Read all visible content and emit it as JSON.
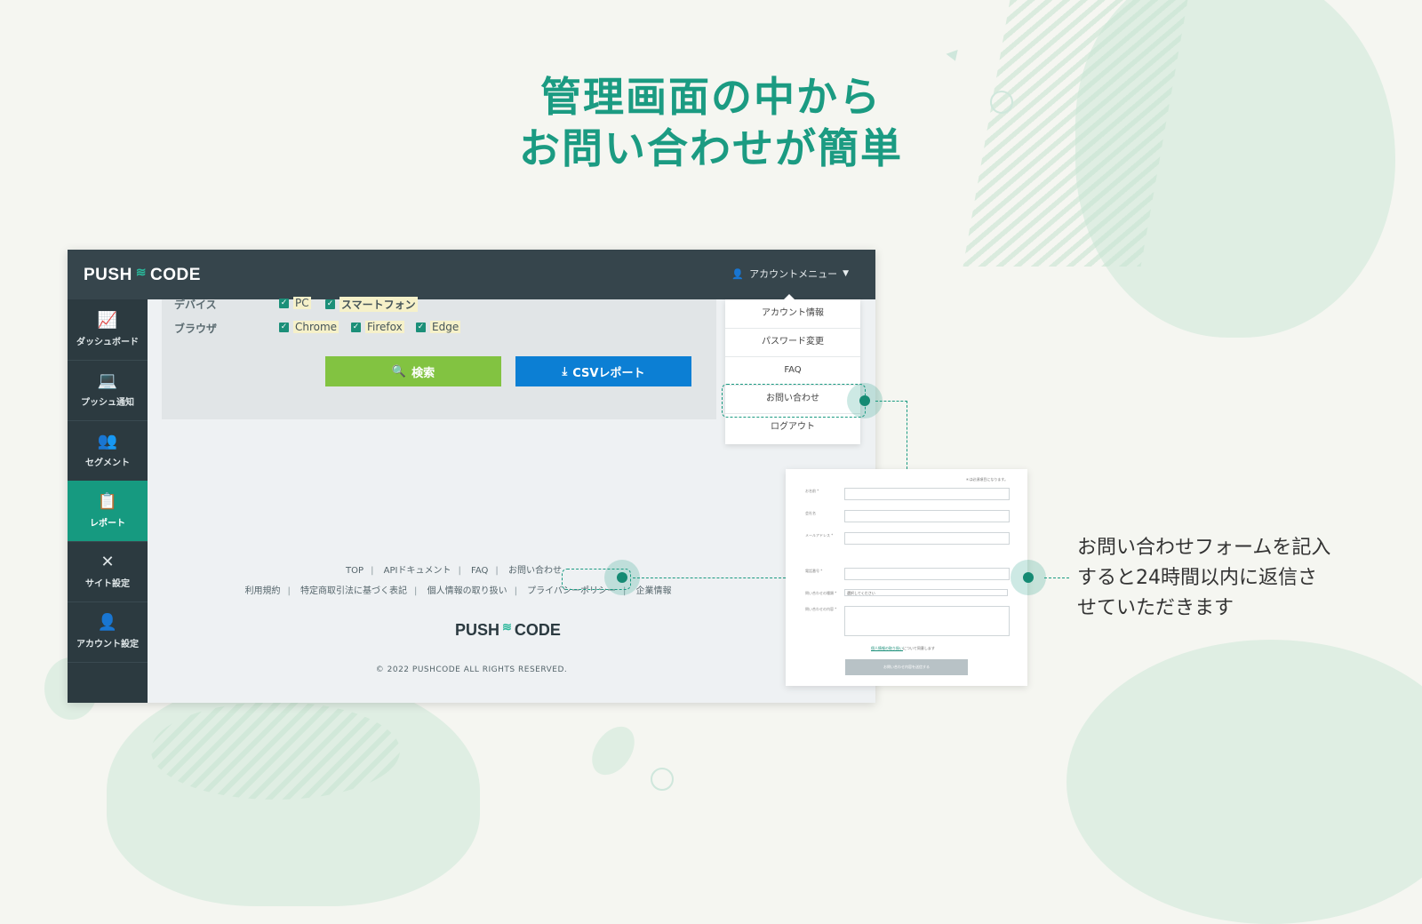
{
  "headline": {
    "line1": "管理画面の中から",
    "line2": "お問い合わせが簡単"
  },
  "app": {
    "logo": {
      "left": "PUSH",
      "right": "CODE"
    },
    "account_menu_label": "アカウントメニュー",
    "sidebar": [
      {
        "label": "ダッシュボード",
        "icon": "chart-icon",
        "active": false
      },
      {
        "label": "プッシュ通知",
        "icon": "laptop-icon",
        "active": false
      },
      {
        "label": "セグメント",
        "icon": "users-icon",
        "active": false
      },
      {
        "label": "レポート",
        "icon": "clipboard-icon",
        "active": true
      },
      {
        "label": "サイト設定",
        "icon": "tools-icon",
        "active": false
      },
      {
        "label": "アカウント設定",
        "icon": "person-icon",
        "active": false
      }
    ],
    "filters": {
      "device_label": "デバイス",
      "device_options": [
        "PC",
        "スマートフォン"
      ],
      "browser_label": "ブラウザ",
      "browser_options": [
        "Chrome",
        "Firefox",
        "Edge"
      ]
    },
    "buttons": {
      "search": "検索",
      "csv": "CSVレポート"
    },
    "dropdown": [
      "アカウント情報",
      "パスワード変更",
      "FAQ",
      "お問い合わせ",
      "ログアウト"
    ],
    "footer": {
      "links_row1": [
        "TOP",
        "APIドキュメント",
        "FAQ",
        "お問い合わせ"
      ],
      "links_row2": [
        "利用規約",
        "特定商取引法に基づく表記",
        "個人情報の取り扱い",
        "プライバシーポリシー",
        "企業情報"
      ],
      "copyright": "© 2022 PUSHCODE ALL RIGHTS RESERVED."
    }
  },
  "form": {
    "note": "＊は必須項目になります。",
    "fields": [
      "お名前 *",
      "会社名",
      "メールアドレス *",
      "電話番号 *",
      "問い合わせの種類 *",
      "問い合わせの内容 *"
    ],
    "select_placeholder": "選択してください",
    "agree_link": "個人情報の取り扱い",
    "agree_text": "について同意します",
    "submit": "お問い合わせ内容を送信する"
  },
  "side_text": {
    "line1": "お問い合わせフォームを記入",
    "line2": "すると24時間以内に返信さ",
    "line3": "せていただきます"
  },
  "colors": {
    "accent": "#1b9b82",
    "topbar": "#36454c",
    "sidebar": "#2c3a40",
    "search_button": "#82c341",
    "csv_button": "#0c7fd4"
  }
}
